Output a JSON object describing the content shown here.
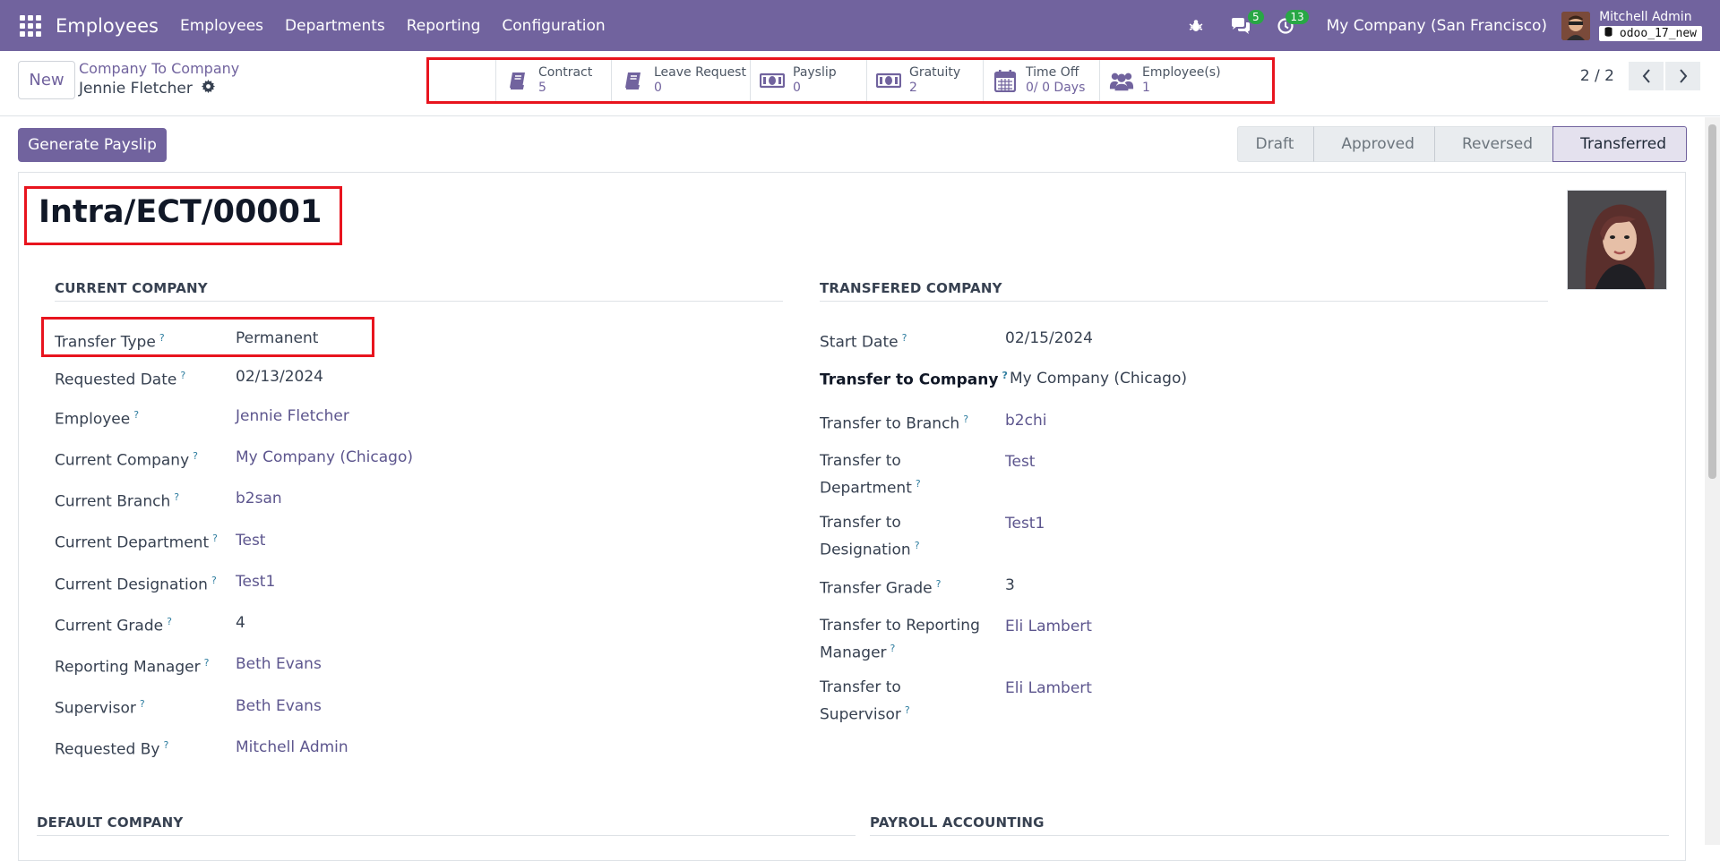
{
  "navbar": {
    "brand": "Employees",
    "menu": [
      "Employees",
      "Departments",
      "Reporting",
      "Configuration"
    ],
    "messages_badge": "5",
    "activities_badge": "13",
    "company": "My Company (San Francisco)",
    "user": "Mitchell Admin",
    "database": "odoo_17_new"
  },
  "control_panel": {
    "new_label": "New",
    "breadcrumb_parent": "Company To Company",
    "breadcrumb_current": "Jennie Fletcher",
    "pager": "2 / 2"
  },
  "stat_buttons": [
    {
      "label": "Contract",
      "value": "5",
      "icon": "book-icon"
    },
    {
      "label": "Leave Request",
      "value": "0",
      "icon": "book-icon"
    },
    {
      "label": "Payslip",
      "value": "0",
      "icon": "money-icon"
    },
    {
      "label": "Gratuity",
      "value": "2",
      "icon": "money-icon"
    },
    {
      "label": "Time Off",
      "value": "0/ 0 Days",
      "icon": "calendar-icon"
    },
    {
      "label": "Employee(s)",
      "value": "1",
      "icon": "users-icon"
    }
  ],
  "actions": {
    "generate_payslip": "Generate Payslip"
  },
  "statusbar": {
    "stages": [
      "Draft",
      "Approved",
      "Reversed",
      "Transferred"
    ],
    "active": "Transferred"
  },
  "record": {
    "title": "Intra/ECT/00001"
  },
  "current_company": {
    "heading": "CURRENT COMPANY",
    "fields": [
      {
        "label": "Transfer Type",
        "value": "Permanent"
      },
      {
        "label": "Requested Date",
        "value": "02/13/2024"
      },
      {
        "label": "Employee",
        "value": "Jennie Fletcher"
      },
      {
        "label": "Current Company",
        "value": "My Company (Chicago)"
      },
      {
        "label": "Current Branch",
        "value": "b2san"
      },
      {
        "label": "Current Department",
        "value": "Test"
      },
      {
        "label": "Current Designation",
        "value": "Test1"
      },
      {
        "label": "Current Grade",
        "value": "4"
      },
      {
        "label": "Reporting Manager",
        "value": "Beth Evans"
      },
      {
        "label": "Supervisor",
        "value": "Beth Evans"
      },
      {
        "label": "Requested By",
        "value": "Mitchell Admin"
      }
    ]
  },
  "transfered_company": {
    "heading": "TRANSFERED COMPANY",
    "fields": [
      {
        "label_1": "Start Date",
        "label_2": "",
        "value": "02/15/2024"
      },
      {
        "label_1": "Transfer to Company",
        "label_2": "",
        "value": "My Company (Chicago)"
      },
      {
        "label_1": "Transfer to Branch",
        "label_2": "",
        "value": "b2chi"
      },
      {
        "label_1": "Transfer to",
        "label_2": "Department",
        "value": "Test"
      },
      {
        "label_1": "Transfer to",
        "label_2": "Designation",
        "value": "Test1"
      },
      {
        "label_1": "Transfer Grade",
        "label_2": "",
        "value": "3"
      },
      {
        "label_1": "Transfer to Reporting",
        "label_2": "Manager",
        "value": "Eli Lambert"
      },
      {
        "label_1": "Transfer to",
        "label_2": "Supervisor",
        "value": "Eli Lambert"
      }
    ]
  },
  "sections": {
    "default_company": "DEFAULT COMPANY",
    "payroll_accounting": "PAYROLL ACCOUNTING"
  },
  "help_mark": "?"
}
